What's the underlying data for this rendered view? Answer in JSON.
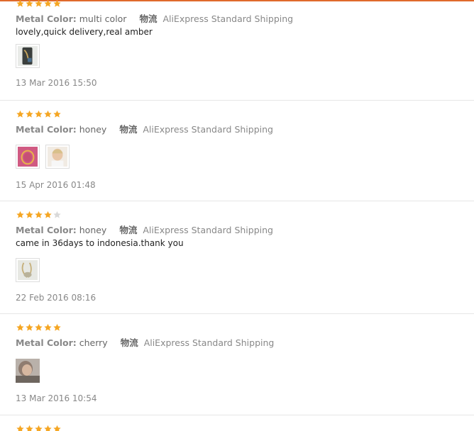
{
  "reviews": [
    {
      "rating": 5,
      "metal_color_label": "Metal Color:",
      "metal_color_value": "multi color",
      "shipping_label": "物流",
      "shipping_value": "AliExpress Standard Shipping",
      "comment": "lovely,quick delivery,real amber",
      "photos": [
        "photo-dark-necklace"
      ],
      "date": "13 Mar 2016 15:50"
    },
    {
      "rating": 5,
      "metal_color_label": "Metal Color:",
      "metal_color_value": "honey",
      "shipping_label": "物流",
      "shipping_value": "AliExpress Standard Shipping",
      "comment": "",
      "photos": [
        "photo-pink-necklace",
        "photo-baby"
      ],
      "date": "15 Apr 2016 01:48"
    },
    {
      "rating": 4,
      "metal_color_label": "Metal Color:",
      "metal_color_value": "honey",
      "shipping_label": "物流",
      "shipping_value": "AliExpress Standard Shipping",
      "comment": "came in 36days to indonesia.thank you",
      "photos": [
        "photo-necklace-light"
      ],
      "date": "22 Feb 2016 08:16"
    },
    {
      "rating": 5,
      "metal_color_label": "Metal Color:",
      "metal_color_value": "cherry",
      "shipping_label": "物流",
      "shipping_value": "AliExpress Standard Shipping",
      "comment": "",
      "photos": [
        "photo-child"
      ],
      "date": "13 Mar 2016 10:54"
    },
    {
      "rating": 5
    }
  ],
  "colors": {
    "star_filled": "#f5a623",
    "star_empty": "#d9d9d9",
    "accent_rule": "#e06a2c"
  }
}
